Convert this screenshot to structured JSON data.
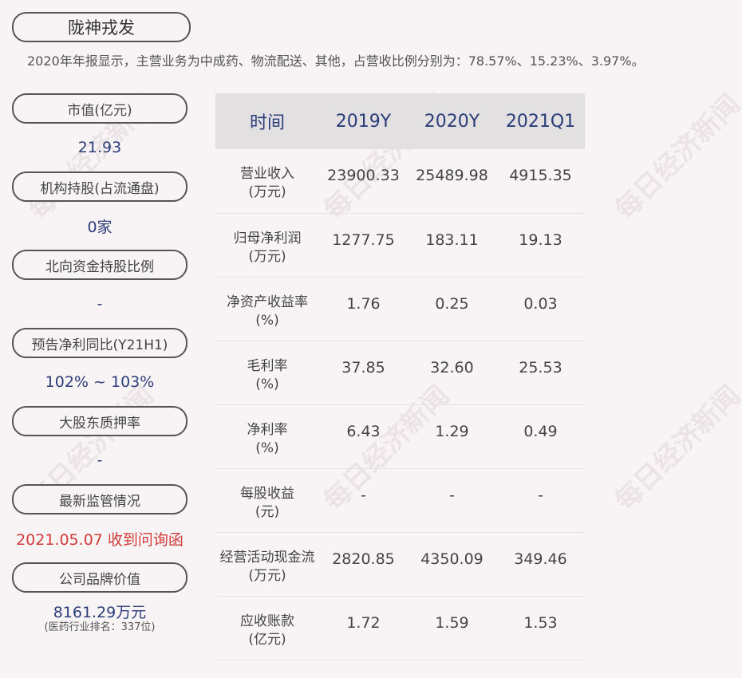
{
  "header": {
    "company": "陇神戎发",
    "summary": "2020年年报显示，主营业务为中成药、物流配送、其他，占营收比例分别为：78.57%、15.23%、3.97%。"
  },
  "stats": [
    {
      "label": "市值(亿元)",
      "value": "21.93"
    },
    {
      "label": "机构持股(占流通盘)",
      "value": "0家"
    },
    {
      "label": "北向资金持股比例",
      "value": "-"
    },
    {
      "label": "预告净利同比(Y21H1)",
      "value": "102% ~ 103%"
    },
    {
      "label": "大股东质押率",
      "value": "-"
    },
    {
      "label": "最新监管情况",
      "value": "2021.05.07 收到问询函"
    },
    {
      "label": "公司品牌价值",
      "value": "8161.29万元",
      "note": "(医药行业排名：337位)"
    }
  ],
  "table": {
    "headers": [
      "时间",
      "2019Y",
      "2020Y",
      "2021Q1"
    ],
    "rows": [
      {
        "metric": "营业收入",
        "unit": "(万元)",
        "values": [
          "23900.33",
          "25489.98",
          "4915.35"
        ]
      },
      {
        "metric": "归母净利润",
        "unit": "(万元)",
        "values": [
          "1277.75",
          "183.11",
          "19.13"
        ]
      },
      {
        "metric": "净资产收益率",
        "unit": "(%)",
        "values": [
          "1.76",
          "0.25",
          "0.03"
        ]
      },
      {
        "metric": "毛利率",
        "unit": "(%)",
        "values": [
          "37.85",
          "32.60",
          "25.53"
        ]
      },
      {
        "metric": "净利率",
        "unit": "(%)",
        "values": [
          "6.43",
          "1.29",
          "0.49"
        ]
      },
      {
        "metric": "每股收益",
        "unit": "(元)",
        "values": [
          "-",
          "-",
          "-"
        ]
      },
      {
        "metric": "经营活动现金流",
        "unit": "(万元)",
        "values": [
          "2820.85",
          "4350.09",
          "349.46"
        ]
      },
      {
        "metric": "应收账款",
        "unit": "(亿元)",
        "values": [
          "1.72",
          "1.59",
          "1.53"
        ]
      }
    ]
  },
  "watermark": "每日经济新闻",
  "colors": {
    "background": "#f8f4f5",
    "value_blue": "#2a3d7a",
    "alert_red": "#d23a3a",
    "header_bg": "#e2e0e1"
  }
}
